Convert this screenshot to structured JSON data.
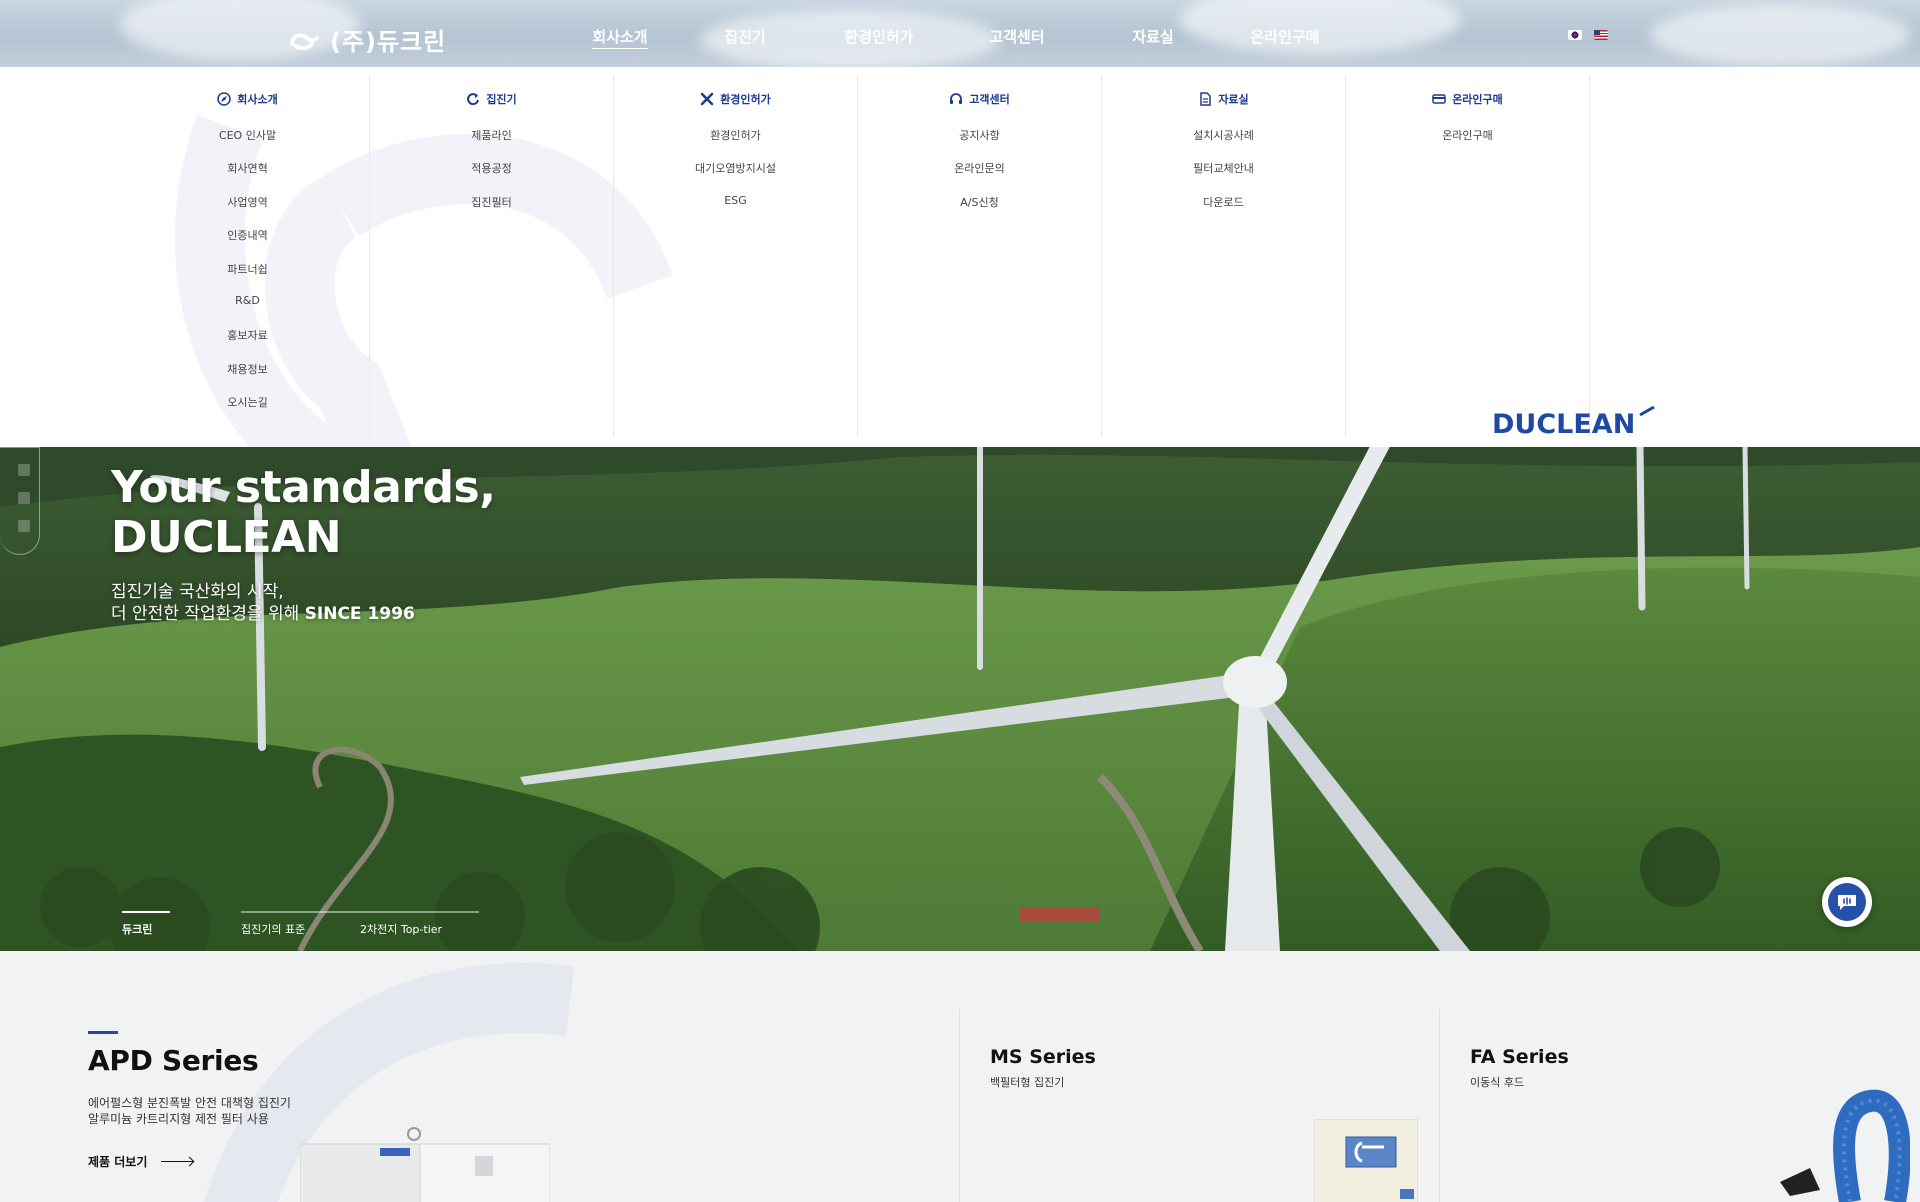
{
  "header": {
    "logo_text": "(주)듀크린",
    "nav": [
      {
        "label": "회사소개",
        "active": true
      },
      {
        "label": "집진기",
        "active": false
      },
      {
        "label": "환경인허가",
        "active": false
      },
      {
        "label": "고객센터",
        "active": false
      },
      {
        "label": "자료실",
        "active": false
      },
      {
        "label": "온라인구매",
        "active": false
      }
    ],
    "languages": [
      "kr-flag-icon",
      "us-flag-icon"
    ]
  },
  "mega_menu": {
    "columns": [
      {
        "title": "회사소개",
        "icon": "compass-icon",
        "items": [
          "CEO 인사말",
          "회사연혁",
          "사업영역",
          "인증내역",
          "파트너쉽",
          "R&D",
          "홍보자료",
          "채용정보",
          "오시는길"
        ]
      },
      {
        "title": "집진기",
        "icon": "refresh-icon",
        "items": [
          "제품라인",
          "적용공정",
          "집진필터"
        ]
      },
      {
        "title": "환경인허가",
        "icon": "tools-icon",
        "items": [
          "환경인허가",
          "대기오염방지시설",
          "ESG"
        ]
      },
      {
        "title": "고객센터",
        "icon": "headset-icon",
        "items": [
          "공지사항",
          "온라인문의",
          "A/S신청"
        ]
      },
      {
        "title": "자료실",
        "icon": "document-icon",
        "items": [
          "설치시공사례",
          "필터교체안내",
          "다운로드"
        ]
      },
      {
        "title": "온라인구매",
        "icon": "card-icon",
        "items": [
          "온라인구매"
        ]
      }
    ],
    "brand_logo": "DUCLEAN"
  },
  "hero": {
    "title_line1": "Your standards,",
    "title_line2": "DUCLEAN",
    "sub_line1": "집진기술 국산화의 시작,",
    "sub_line2_prefix": "더 안전한 작업환경을 위해 ",
    "sub_line2_bold": "SINCE 1996",
    "slides": [
      {
        "label": "듀크린",
        "active": true
      },
      {
        "label": "집진기의 표준",
        "active": false
      },
      {
        "label": "2차전지 Top-tier",
        "active": false
      }
    ]
  },
  "products": {
    "apd": {
      "title": "APD Series",
      "desc_line1": "에어펄스형 분진폭발 안전 대책형 집진기",
      "desc_line2": "알루미늄 카트리지형 제전 필터 사용",
      "more_label": "제품 더보기"
    },
    "ms": {
      "title": "MS Series",
      "desc": "백필터형 집진기"
    },
    "fa": {
      "title": "FA Series",
      "desc": "이동식 후드"
    }
  },
  "colors": {
    "brand_blue": "#1f4aa3",
    "menu_title": "#1b3b8f",
    "chat_button": "#2552a8"
  }
}
